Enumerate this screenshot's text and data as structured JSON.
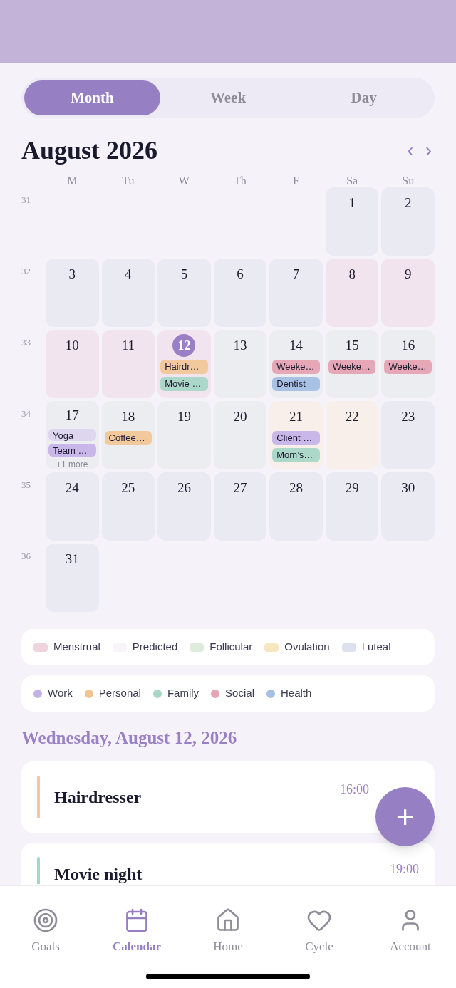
{
  "view_tabs": [
    {
      "label": "Month",
      "selected": true
    },
    {
      "label": "Week",
      "selected": false
    },
    {
      "label": "Day",
      "selected": false
    }
  ],
  "month_title": "August 2026",
  "prev": "‹",
  "next": "›",
  "weekdays": [
    "M",
    "Tu",
    "W",
    "Th",
    "F",
    "Sa",
    "Su"
  ],
  "weeks": [
    {
      "number": "31",
      "days": [
        {
          "kind": "blank"
        },
        {
          "kind": "blank"
        },
        {
          "kind": "blank"
        },
        {
          "kind": "blank"
        },
        {
          "kind": "blank"
        },
        {
          "kind": "day",
          "date": "1",
          "color": "#eaeaf3",
          "today": false
        },
        {
          "kind": "day",
          "date": "2",
          "color": "#eaeaf3",
          "today": false
        }
      ]
    },
    {
      "number": "32",
      "days": [
        {
          "kind": "day",
          "date": "3",
          "color": "#eaeaf3",
          "today": false
        },
        {
          "kind": "day",
          "date": "4",
          "color": "#eaeaf3",
          "today": false
        },
        {
          "kind": "day",
          "date": "5",
          "color": "#eaeaf3",
          "today": false
        },
        {
          "kind": "day",
          "date": "6",
          "color": "#eaeaf3",
          "today": false
        },
        {
          "kind": "day",
          "date": "7",
          "color": "#eaeaf3",
          "today": false
        },
        {
          "kind": "day",
          "date": "8",
          "color": "#f2e4ee",
          "today": false
        },
        {
          "kind": "day",
          "date": "9",
          "color": "#f2e4ee",
          "today": false
        }
      ]
    },
    {
      "number": "33",
      "days": [
        {
          "kind": "day",
          "date": "10",
          "color": "#f2e4ee",
          "today": false
        },
        {
          "kind": "day",
          "date": "11",
          "color": "#f2e4ee",
          "today": false
        },
        {
          "kind": "day",
          "date": "12",
          "color": "#f2e4ee",
          "today": true,
          "events": [
            {
              "label": "Hairdr…",
              "color": "#f2c99c"
            },
            {
              "label": "Movie …",
              "color": "#acd8ca"
            }
          ]
        },
        {
          "kind": "day",
          "date": "13",
          "color": "#ecedf0",
          "today": false
        },
        {
          "kind": "day",
          "date": "14",
          "color": "#ecedf0",
          "today": false,
          "events": [
            {
              "label": "Weeke…",
              "color": "#e6a7b6"
            },
            {
              "label": "Dentist",
              "color": "#a8c2e5"
            }
          ]
        },
        {
          "kind": "day",
          "date": "15",
          "color": "#ecedf0",
          "today": false,
          "events": [
            {
              "label": "Weeke…",
              "color": "#e6a7b6"
            }
          ]
        },
        {
          "kind": "day",
          "date": "16",
          "color": "#ecedf0",
          "today": false,
          "events": [
            {
              "label": "Weeke…",
              "color": "#e6a7b6"
            }
          ]
        }
      ]
    },
    {
      "number": "34",
      "days": [
        {
          "kind": "day",
          "date": "17",
          "color": "#ecedf0",
          "today": false,
          "events": [
            {
              "label": "Yoga",
              "color": "#ddd6ee"
            },
            {
              "label": "Team …",
              "color": "#c8b7e8"
            }
          ],
          "more": "+1 more"
        },
        {
          "kind": "day",
          "date": "18",
          "color": "#ecedf0",
          "today": false,
          "events": [
            {
              "label": "Coffee…",
              "color": "#f2c99c"
            }
          ]
        },
        {
          "kind": "day",
          "date": "19",
          "color": "#ecedf0",
          "today": false
        },
        {
          "kind": "day",
          "date": "20",
          "color": "#ecedf0",
          "today": false
        },
        {
          "kind": "day",
          "date": "21",
          "color": "#f8efea",
          "today": false,
          "events": [
            {
              "label": "Client …",
              "color": "#c8b7e8"
            },
            {
              "label": "Mom’s…",
              "color": "#acd8ca"
            }
          ]
        },
        {
          "kind": "day",
          "date": "22",
          "color": "#f8efea",
          "today": false
        },
        {
          "kind": "day",
          "date": "23",
          "color": "#eaeaf3",
          "today": false
        }
      ]
    },
    {
      "number": "35",
      "days": [
        {
          "kind": "day",
          "date": "24",
          "color": "#eaeaf3",
          "today": false
        },
        {
          "kind": "day",
          "date": "25",
          "color": "#eaeaf3",
          "today": false
        },
        {
          "kind": "day",
          "date": "26",
          "color": "#eaeaf3",
          "today": false
        },
        {
          "kind": "day",
          "date": "27",
          "color": "#eaeaf3",
          "today": false
        },
        {
          "kind": "day",
          "date": "28",
          "color": "#eaeaf3",
          "today": false
        },
        {
          "kind": "day",
          "date": "29",
          "color": "#eaeaf3",
          "today": false
        },
        {
          "kind": "day",
          "date": "30",
          "color": "#eaeaf3",
          "today": false
        }
      ]
    },
    {
      "number": "36",
      "days": [
        {
          "kind": "day",
          "date": "31",
          "color": "#eaeaf3",
          "today": false
        }
      ]
    }
  ],
  "phase_legend": [
    {
      "label": "Menstrual",
      "color": "#f0d4dd"
    },
    {
      "label": "Predicted",
      "color": "#f7f5f8"
    },
    {
      "label": "Follicular",
      "color": "#ddecdd"
    },
    {
      "label": "Ovulation",
      "color": "#f6e7c0"
    },
    {
      "label": "Luteal",
      "color": "#dce2ed"
    }
  ],
  "category_legend": [
    {
      "label": "Work",
      "color": "#c4b1e6"
    },
    {
      "label": "Personal",
      "color": "#f0c596"
    },
    {
      "label": "Family",
      "color": "#a9d5c7"
    },
    {
      "label": "Social",
      "color": "#e6a4b4"
    },
    {
      "label": "Health",
      "color": "#a4bee4"
    }
  ],
  "selected_date": "Wednesday, August 12, 2026",
  "agenda": [
    {
      "title": "Hairdresser",
      "time": "16:00",
      "color": "#f0c99e"
    },
    {
      "title": "Movie night",
      "time": "19:00",
      "color": "#a9d5c7"
    }
  ],
  "fab": "+",
  "nav": [
    {
      "label": "Goals",
      "selected": false
    },
    {
      "label": "Calendar",
      "selected": true
    },
    {
      "label": "Home",
      "selected": false
    },
    {
      "label": "Cycle",
      "selected": false
    },
    {
      "label": "Account",
      "selected": false
    }
  ]
}
